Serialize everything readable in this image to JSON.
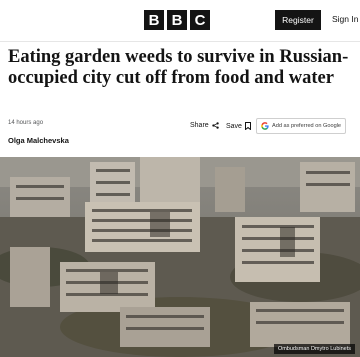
{
  "header": {
    "logo_letters": [
      "B",
      "B",
      "C"
    ],
    "register_label": "Register",
    "signin_label": "Sign In"
  },
  "article": {
    "headline": "Eating garden weeds to survive in Russian-occupied city cut off from food and water",
    "timestamp": "14 hours ago",
    "author": "Olga Malchevska",
    "share_label": "Share",
    "save_label": "Save",
    "google_label": "Add as preferred on Google",
    "image_caption": "Ombudsman Dmytro Lubinets"
  },
  "colors": {
    "brand_black": "#141414",
    "text_secondary": "#545658"
  },
  "icons": {
    "share": "share-icon",
    "save": "bookmark-icon",
    "google": "google-icon"
  }
}
